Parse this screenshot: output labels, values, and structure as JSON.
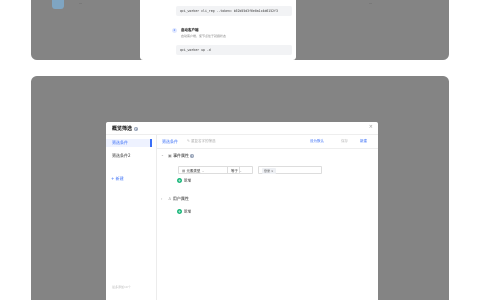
{
  "top_card": {
    "left_faint_text": "…",
    "right_faint_text": "…",
    "code_line_1": "qci_worker cli_reg --token= b52b55d3f6e0a1c4d6152f3",
    "step2_title": "启动客户端",
    "step2_desc": "启动客户端，使节点处于就绪状态",
    "code_line_2": "qci_worker up -d"
  },
  "modal": {
    "title": "概览筛选",
    "close": "×",
    "sidebar": {
      "items": [
        {
          "label": "筛选条件"
        },
        {
          "label": "筛选条件2"
        }
      ],
      "add_label": "+ 新建",
      "footer": "最多添加10个"
    },
    "tabs": {
      "active_label": "筛选条件",
      "edit_label": "✎ 重复名字的筛选",
      "save_default_label": "设为默认",
      "save_label": "保存",
      "new_label": "新建"
    },
    "event_group": {
      "label": "事件属性",
      "condition": {
        "property": "元素类型",
        "operator": "等于",
        "value_chip": "登录"
      },
      "add_label": "新增"
    },
    "user_group": {
      "label": "用户属性",
      "add_label": "新增"
    }
  },
  "colors": {
    "accent": "#3a6ff7",
    "add_green": "#1fb87d",
    "overlay": "#848484"
  }
}
